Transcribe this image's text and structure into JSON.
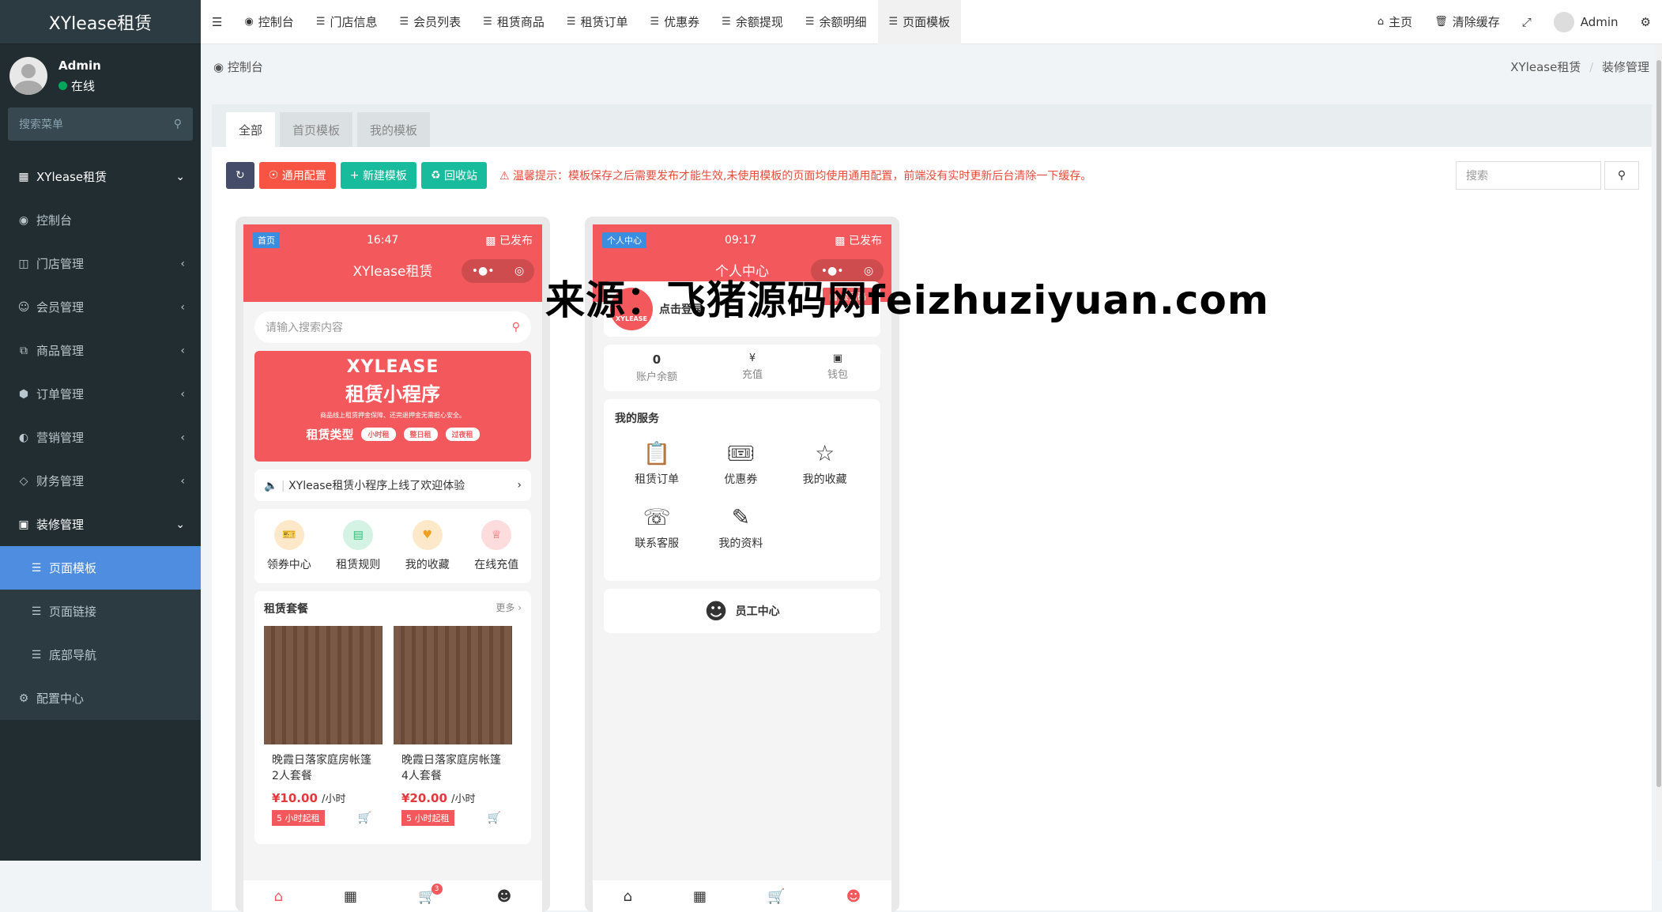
{
  "sidebar": {
    "logo": "XYlease租赁",
    "user_name": "Admin",
    "user_status": "在线",
    "search_placeholder": "搜索菜单",
    "items": [
      {
        "label": "XYlease租赁",
        "icon": "grid-icon"
      },
      {
        "label": "控制台",
        "icon": "dashboard-icon"
      },
      {
        "label": "门店管理",
        "icon": "book-icon"
      },
      {
        "label": "会员管理",
        "icon": "user-circle-icon"
      },
      {
        "label": "商品管理",
        "icon": "clone-icon"
      },
      {
        "label": "订单管理",
        "icon": "cube-icon"
      },
      {
        "label": "营销管理",
        "icon": "gauge-icon"
      },
      {
        "label": "财务管理",
        "icon": "diamond-icon"
      },
      {
        "label": "装修管理",
        "icon": "camera-icon"
      },
      {
        "label": "页面模板",
        "icon": "list-icon"
      },
      {
        "label": "页面链接",
        "icon": "list-icon"
      },
      {
        "label": "底部导航",
        "icon": "list-icon"
      },
      {
        "label": "配置中心",
        "icon": "gear-icon"
      }
    ]
  },
  "topbar": {
    "tabs": [
      "控制台",
      "门店信息",
      "会员列表",
      "租赁商品",
      "租赁订单",
      "优惠券",
      "余额提现",
      "余额明细",
      "页面模板"
    ],
    "home": "主页",
    "clear_cache": "清除缓存",
    "admin": "Admin"
  },
  "content": {
    "crumb_left": "控制台",
    "crumb_right_1": "XYlease租赁",
    "crumb_sep": "/",
    "crumb_right_2": "装修管理",
    "tabs": [
      "全部",
      "首页模板",
      "我的模板"
    ],
    "btn_config": "通用配置",
    "btn_new": "新建模板",
    "btn_recycle": "回收站",
    "warning": "温馨提示：模板保存之后需要发布才能生效,未使用模板的页面均使用通用配置，前端没有实时更新后台清除一下缓存。",
    "search_placeholder": "搜索"
  },
  "phone1": {
    "tag": "首页",
    "time": "16:47",
    "published": "已发布",
    "title": "XYlease租赁",
    "search_placeholder": "请输入搜索内容",
    "banner_brand": "XYLEASE",
    "banner_title": "租赁小程序",
    "banner_sub": "商品线上租赁押金保障、还完退押金无需担心安全。",
    "banner_type": "租赁类型",
    "banner_tags": [
      "小时租",
      "整日租",
      "过夜租"
    ],
    "notice": "XYlease租赁小程序上线了欢迎体验",
    "icons": [
      "领券中心",
      "租赁规则",
      "我的收藏",
      "在线充值"
    ],
    "section_title": "租赁套餐",
    "more": "更多",
    "products": [
      {
        "name": "晚霞日落家庭房帐篷2人套餐",
        "price": "¥10.00",
        "unit": "/小时",
        "badge": "5 小时起租"
      },
      {
        "name": "晚霞日落家庭房帐篷4人套餐",
        "price": "¥20.00",
        "unit": "/小时",
        "badge": "5 小时起租"
      }
    ],
    "cart_count": "3"
  },
  "phone2": {
    "tag": "个人中心",
    "time": "09:17",
    "published": "已发布",
    "title": "个人中心",
    "login": "点击登录",
    "member_code": "会员码",
    "logo_text": "XYLEASE",
    "balance_value": "0",
    "balance_label": "账户余额",
    "recharge": "充值",
    "wallet": "钱包",
    "services_title": "我的服务",
    "services": [
      "租赁订单",
      "优惠券",
      "我的收藏",
      "联系客服",
      "我的资料"
    ],
    "staff": "员工中心"
  },
  "watermark": "来源：飞猪源码网feizhuziyuan.com"
}
